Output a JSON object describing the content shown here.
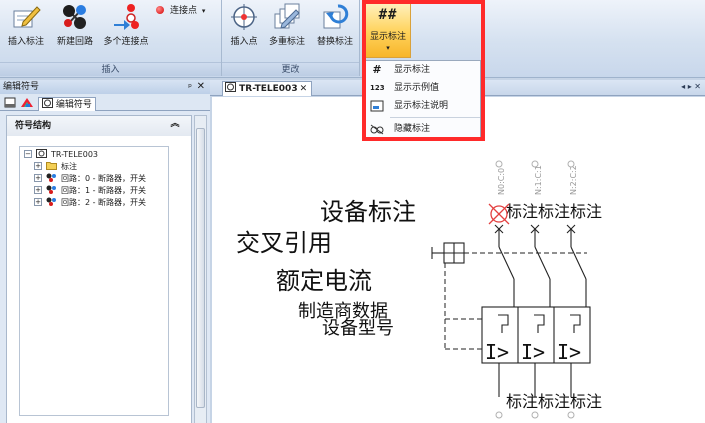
{
  "ribbon": {
    "insert_group": {
      "label": "插入",
      "buttons": [
        {
          "label": "插入标注",
          "icon": "pencil-annotate-icon"
        },
        {
          "label": "新建回路",
          "icon": "molecule-circuit-icon"
        },
        {
          "label": "多个连接点",
          "icon": "connection-points-icon"
        }
      ],
      "connection_point": {
        "label": "连接点",
        "caret": "▾"
      }
    },
    "change_group": {
      "label": "更改",
      "buttons": [
        {
          "label": "插入点",
          "icon": "crosshair-point-icon"
        },
        {
          "label": "多重标注",
          "icon": "multi-annotate-icon"
        },
        {
          "label": "替换标注",
          "icon": "replace-annotate-icon"
        }
      ]
    },
    "show_button": {
      "label": "显示标注",
      "icon_text": "##",
      "caret": "▾"
    },
    "dropdown": [
      {
        "icon_text": "#",
        "label": "显示标注"
      },
      {
        "icon_text": "123",
        "label": "显示示例值"
      },
      {
        "icon_text": "",
        "label": "显示标注说明"
      },
      {
        "icon_text": "",
        "label": "隐藏标注"
      }
    ]
  },
  "left_panel": {
    "title": "编辑符号",
    "pin": "ᵖ",
    "close": "✕",
    "tab_label": "编辑符号",
    "header": "符号结构",
    "collapse": "︽",
    "tree": {
      "root": "TR-TELE003",
      "children": [
        "标注",
        "回路：0 - 断路器，开关",
        "回路：1 - 断路器，开关",
        "回路：2 - 断路器，开关"
      ]
    }
  },
  "document": {
    "tab_label": "TR-TELE003",
    "tab_close": "✕",
    "nav": "◂ ▸ ✕",
    "texts": {
      "device_annotation": "设备标注",
      "cross_reference": "交叉引用",
      "rated_current": "额定电流",
      "manufacturer_data": "制造商数据",
      "device_model": "设备型号",
      "top_annotations": "标注标注标注",
      "bottom_annotations": "标注标注标注"
    },
    "pin_labels_top": [
      "N0:C:0",
      "N:1:C:1",
      "N:2:C:2"
    ],
    "contact_symbol": "I>"
  },
  "colors": {
    "highlight_border": "#ff2a2a",
    "active_button": "#ffd35c",
    "ribbon_bg": "#d5e1f0"
  }
}
